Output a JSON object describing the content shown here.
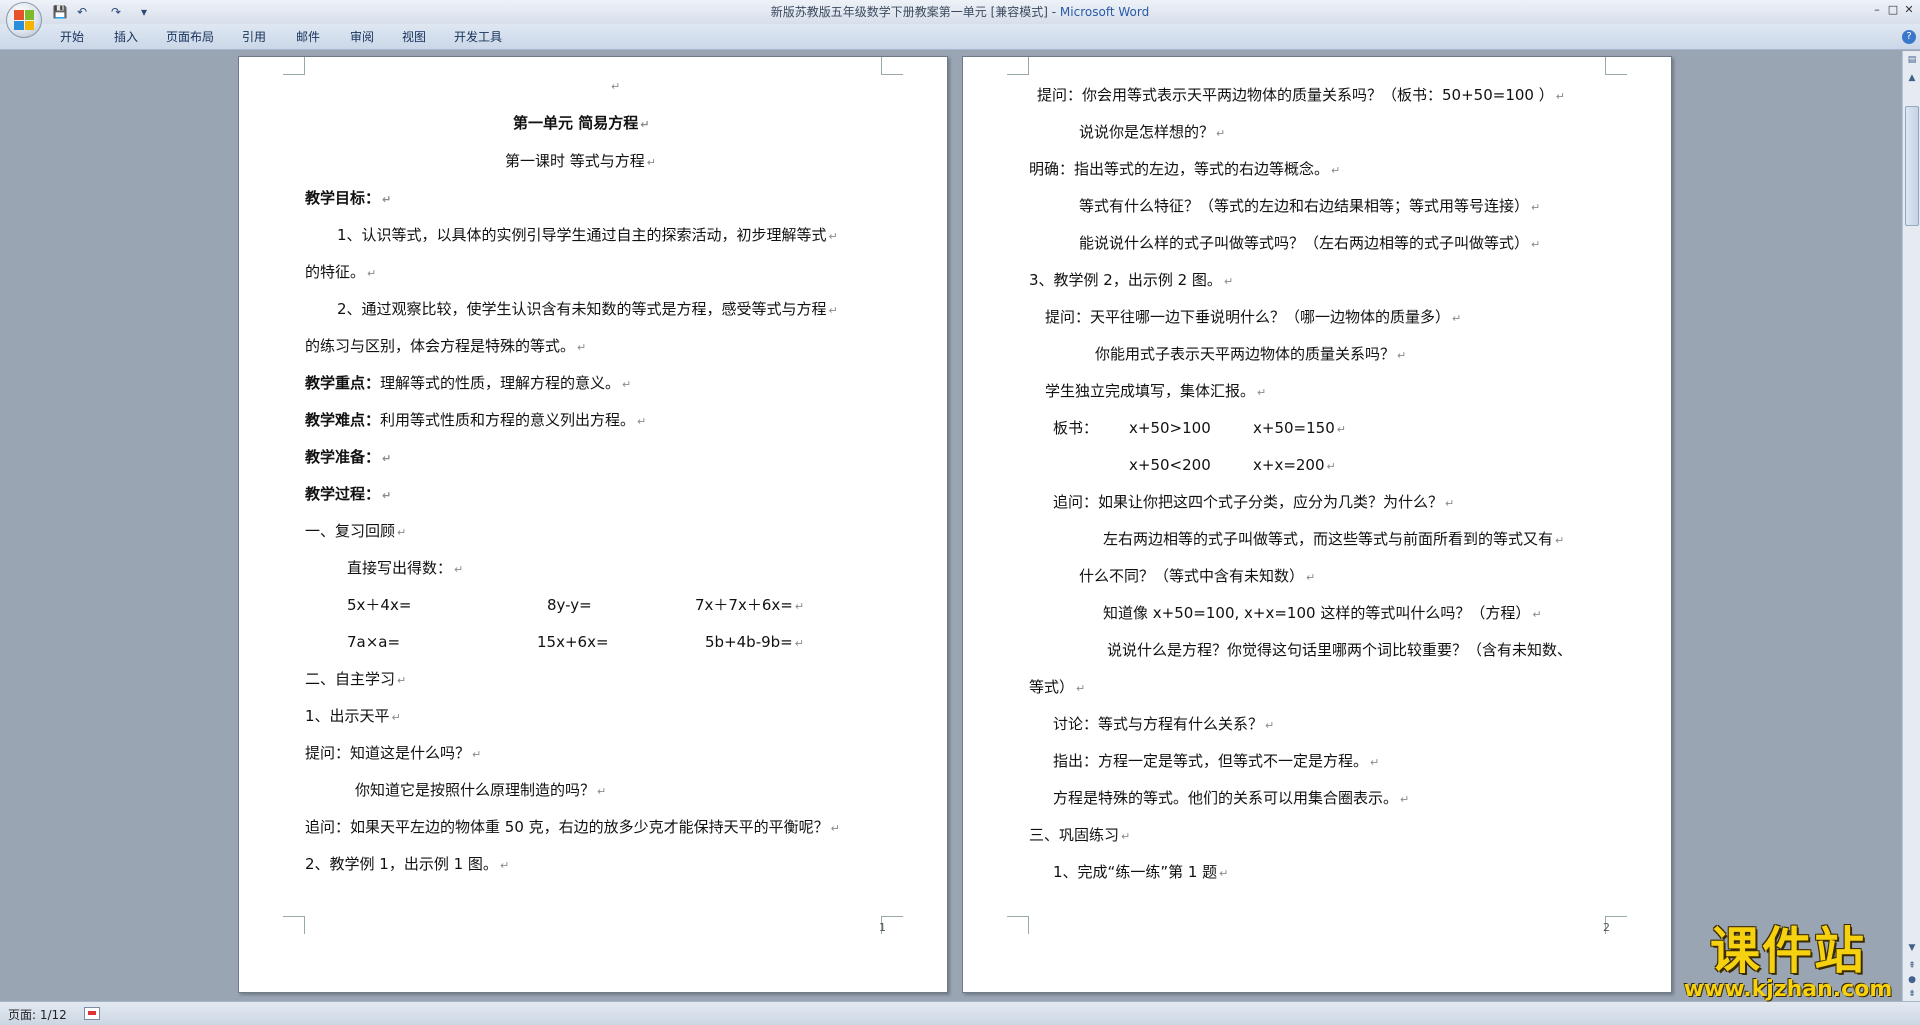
{
  "titlebar": {
    "title": "新版苏教版五年级数学下册教案第一单元 [兼容模式] - ",
    "app_name": "Microsoft Word",
    "qa_save": "💾",
    "qa_undo": "↶",
    "qa_redo": "↷",
    "qa_more": "▾",
    "minimize": "–",
    "maximize": "□",
    "close": "✕"
  },
  "ribbon": {
    "tabs": [
      "开始",
      "插入",
      "页面布局",
      "引用",
      "邮件",
      "审阅",
      "视图",
      "开发工具"
    ],
    "help": "?"
  },
  "colors": {
    "accent": "#2a5aa8",
    "workspace": "#9aa5b4"
  },
  "pilcrow": "↵",
  "page1": {
    "lines": [
      "",
      "第一单元   简易方程",
      "第一课时     等式与方程",
      "教学目标：",
      "1、认识等式，以具体的实例引导学生通过自主的探索活动，初步理解等式",
      "的特征。",
      "2、通过观察比较，使学生认识含有未知数的等式是方程，感受等式与方程",
      "的练习与区别，体会方程是特殊的等式。",
      "教学重点：",
      "理解等式的性质，理解方程的意义。",
      "教学难点：",
      "利用等式性质和方程的意义列出方程。",
      "教学准备：",
      "教学过程：",
      "一、复习回顾",
      "直接写出得数：",
      "5x＋4x=",
      "8y-y=",
      "7x＋7x＋6x=",
      "7a×a=",
      "15x+6x=",
      "5b+4b-9b=",
      "二、自主学习",
      "1、出示天平",
      "提问：知道这是什么吗？",
      "你知道它是按照什么原理制造的吗？",
      "追问：如果天平左边的物体重 50 克，右边的放多少克才能保持天平的平衡呢？",
      "2、教学例 1，出示例 1 图。"
    ],
    "page_number": "1"
  },
  "page2": {
    "lines": [
      "提问：你会用等式表示天平两边物体的质量关系吗？（板书：50+50=100 ）",
      "说说你是怎样想的？",
      "明确：指出等式的左边，等式的右边等概念。",
      "等式有什么特征？（等式的左边和右边结果相等；等式用等号连接）",
      "能说说什么样的式子叫做等式吗？（左右两边相等的式子叫做等式）",
      "3、教学例 2，出示例 2 图。",
      "提问：天平往哪一边下垂说明什么？（哪一边物体的质量多）",
      "你能用式子表示天平两边物体的质量关系吗？",
      "学生独立完成填写，集体汇报。",
      "板书：",
      "x+50>100",
      "x+50=150",
      "x+50<200",
      "x+x=200",
      "追问：如果让你把这四个式子分类，应分为几类？为什么？",
      "左右两边相等的式子叫做等式，而这些等式与前面所看到的等式又有",
      "什么不同？（等式中含有未知数）",
      "知道像 x+50=100, x+x=100 这样的等式叫什么吗？（方程）",
      "说说什么是方程？你觉得这句话里哪两个词比较重要？（含有未知数、",
      "等式）",
      "讨论：等式与方程有什么关系？",
      "指出：方程一定是等式，但等式不一定是方程。",
      "方程是特殊的等式。他们的关系可以用集合圈表示。",
      "三、巩固练习",
      "1、完成“练一练”第 1 题"
    ],
    "page_number": "2"
  },
  "status": {
    "page_info": "页面: 1/12"
  },
  "watermark": {
    "text": "课件站",
    "url": "www.kjzhan.com"
  }
}
